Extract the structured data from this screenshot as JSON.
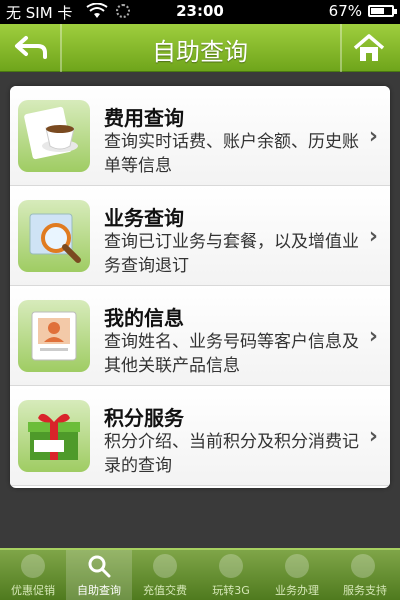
{
  "status": {
    "carrier": "无 SIM 卡",
    "time": "23:00",
    "battery": "67%",
    "battery_level": 0.67
  },
  "titlebar": {
    "title": "自助查询",
    "back_icon": "back-arrow-icon",
    "home_icon": "home-icon"
  },
  "items": [
    {
      "name": "费用查询",
      "desc": "查询实时话费、账户余额、历史账单等信息",
      "icon": "teacup-icon"
    },
    {
      "name": "业务查询",
      "desc": "查询已订业务与套餐，以及增值业务查询退订",
      "icon": "magnifier-icon"
    },
    {
      "name": "我的信息",
      "desc": "查询姓名、业务号码等客户信息及其他关联产品信息",
      "icon": "contact-card-icon"
    },
    {
      "name": "积分服务",
      "desc": "积分介绍、当前积分及积分消费记录的查询",
      "icon": "gift-box-icon"
    }
  ],
  "tabs": [
    {
      "label": "优惠促销",
      "icon": "gift-icon"
    },
    {
      "label": "自助查询",
      "icon": "search-icon"
    },
    {
      "label": "充值交费",
      "icon": "coin-icon"
    },
    {
      "label": "玩转3G",
      "icon": "3g-icon"
    },
    {
      "label": "业务办理",
      "icon": "person-icon"
    },
    {
      "label": "服务支持",
      "icon": "support-icon"
    }
  ],
  "active_tab": 1,
  "colors": {
    "accent_green": "#7fb628",
    "tabbar_green": "#5f8a2a"
  }
}
